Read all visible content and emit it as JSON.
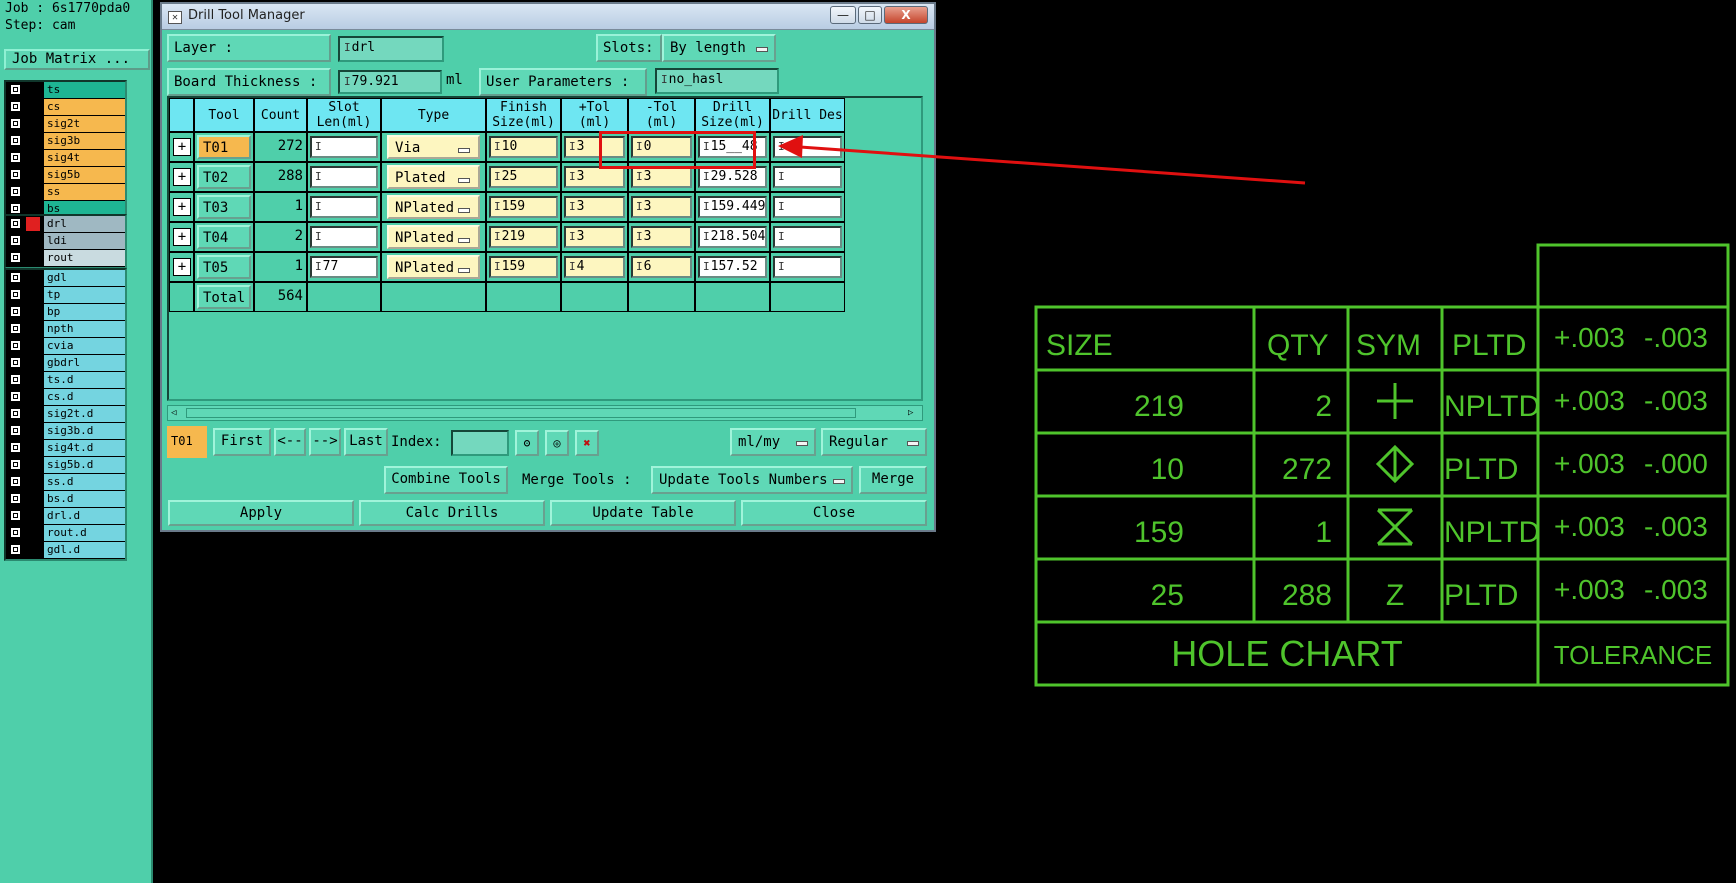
{
  "left_panel": {
    "job_line": "Job : 6s1770pda0",
    "step_line": "Step: cam",
    "job_matrix_button": "Job Matrix ...",
    "layers_top": [
      "ts",
      "cs",
      "sig2t",
      "sig3b",
      "sig4t",
      "sig5b",
      "ss",
      "bs"
    ],
    "layers_mid": [
      "drl",
      "ldi",
      "rout"
    ],
    "layers_bottom": [
      "gdl",
      "tp",
      "bp",
      "npth",
      "cvia",
      "gbdrl",
      "ts.d",
      "cs.d",
      "sig2t.d",
      "sig3b.d",
      "sig4t.d",
      "sig5b.d",
      "ss.d",
      "bs.d",
      "drl.d",
      "rout.d",
      "gdl.d"
    ]
  },
  "dialog": {
    "title": "Drill Tool Manager",
    "layer_label": "Layer           :",
    "layer_value": "drl",
    "slots_label": "Slots:",
    "slots_value": "By length",
    "board_thickness_label": "Board Thickness :",
    "board_thickness_value": "79.921",
    "board_thickness_unit": "ml",
    "user_params_label": "User Parameters :",
    "user_params_value": "no_hasl",
    "columns": [
      "Tool",
      "Count",
      "Slot Len(ml)",
      "Type",
      "Finish Size(ml)",
      "+Tol (ml)",
      "-Tol (ml)",
      "Drill Size(ml)",
      "Drill Des"
    ],
    "rows": [
      {
        "tool": "T01",
        "count": "272",
        "slot": "",
        "type": "Via",
        "finish": "10",
        "ptol": "3",
        "mtol": "0",
        "drill": "15__48",
        "des": ""
      },
      {
        "tool": "T02",
        "count": "288",
        "slot": "",
        "type": "Plated",
        "finish": "25",
        "ptol": "3",
        "mtol": "3",
        "drill": "29.528",
        "des": ""
      },
      {
        "tool": "T03",
        "count": "1",
        "slot": "",
        "type": "NPlated",
        "finish": "159",
        "ptol": "3",
        "mtol": "3",
        "drill": "159.449",
        "des": ""
      },
      {
        "tool": "T04",
        "count": "2",
        "slot": "",
        "type": "NPlated",
        "finish": "219",
        "ptol": "3",
        "mtol": "3",
        "drill": "218.504",
        "des": ""
      },
      {
        "tool": "T05",
        "count": "1",
        "slot": "77",
        "type": "NPlated",
        "finish": "159",
        "ptol": "4",
        "mtol": "6",
        "drill": "157.52",
        "des": ""
      }
    ],
    "total_label": "Total",
    "total_count": "564",
    "nav": {
      "current": "T01",
      "first": "First",
      "prev": "<--",
      "next": "-->",
      "last": "Last",
      "index_label": "Index:",
      "units_value": "ml/my",
      "mode_value": "Regular"
    },
    "combine_tools": "Combine Tools",
    "merge_tools_label": "Merge Tools :",
    "merge_tools_value": "Update Tools Numbers",
    "merge_button": "Merge",
    "apply": "Apply",
    "calc_drills": "Calc Drills",
    "update_table": "Update Table",
    "close": "Close",
    "win_min": "—",
    "win_max": "□",
    "win_close": "X"
  },
  "hole_chart": {
    "headers": [
      "SIZE",
      "QTY",
      "SYM",
      "PLTD"
    ],
    "tol_header": [
      "+.003",
      "-.003"
    ],
    "rows": [
      {
        "size": "219",
        "qty": "2",
        "sym": "plus-symbol",
        "pltd": "NPLTD",
        "ptol": "+.003",
        "mtol": "-.003"
      },
      {
        "size": "10",
        "qty": "272",
        "sym": "diamond-symbol",
        "pltd": "PLTD",
        "ptol": "+.003",
        "mtol": "-.000"
      },
      {
        "size": "159",
        "qty": "1",
        "sym": "hourglass-symbol",
        "pltd": "NPLTD",
        "ptol": "+.003",
        "mtol": "-.003"
      },
      {
        "size": "25",
        "qty": "288",
        "sym": "Z",
        "pltd": "PLTD",
        "ptol": "+.003",
        "mtol": "-.003"
      }
    ],
    "title": "HOLE CHART",
    "tolerance_label": "TOLERANCE"
  },
  "colors": {
    "line": "#4fc42c",
    "annotation": "#e01010",
    "panel": "#4fcfaa",
    "highlight": "#f6b84e"
  }
}
